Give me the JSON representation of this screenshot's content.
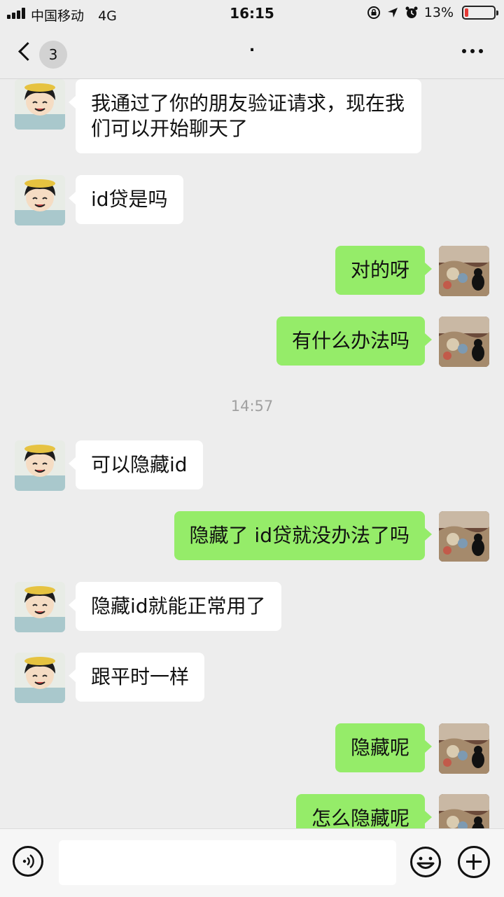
{
  "status_bar": {
    "carrier": "中国移动",
    "network": "4G",
    "time": "16:15",
    "battery_text": "13%",
    "battery_level": 0.13,
    "battery_color": "#e53935",
    "icons": [
      "orientation-lock-icon",
      "location-icon",
      "alarm-icon"
    ]
  },
  "nav": {
    "back_label": "3",
    "title": "."
  },
  "timestamps": {
    "t1": "14:57"
  },
  "messages": [
    {
      "side": "left",
      "text": "我通过了你的朋友验证请求，现在我们可以开始聊天了"
    },
    {
      "side": "left",
      "text": "id贷是吗"
    },
    {
      "side": "right",
      "text": "对的呀"
    },
    {
      "side": "right",
      "text": "有什么办法吗"
    },
    {
      "side": "left",
      "text": "可以隐藏id"
    },
    {
      "side": "right",
      "text": "隐藏了 id贷就没办法了吗"
    },
    {
      "side": "left",
      "text": "隐藏id就能正常用了"
    },
    {
      "side": "left",
      "text": "跟平时一样"
    },
    {
      "side": "right",
      "text": "隐藏呢"
    },
    {
      "side": "right",
      "text": "怎么隐藏呢"
    }
  ],
  "input": {
    "value": "",
    "placeholder": ""
  },
  "colors": {
    "sent_bubble": "#95ec69",
    "received_bubble": "#ffffff",
    "background": "#ededed"
  }
}
